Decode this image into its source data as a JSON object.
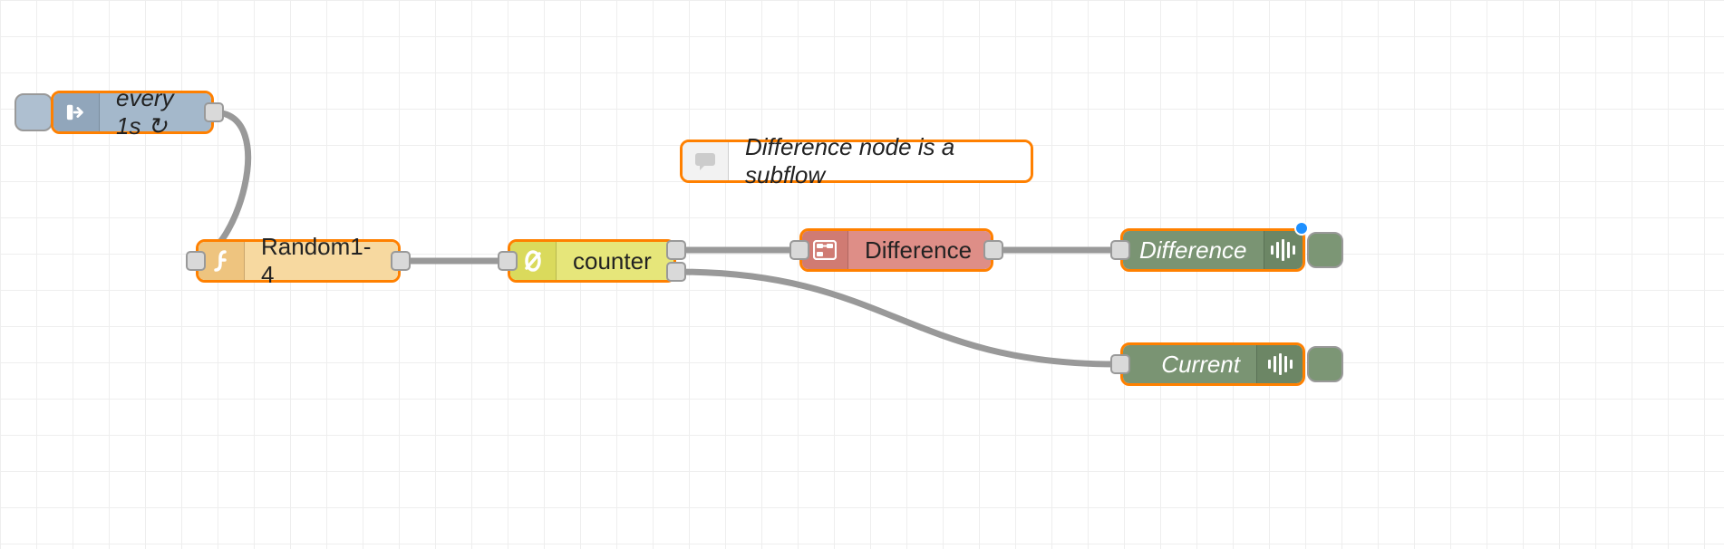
{
  "nodes": {
    "inject": {
      "label": "every 1s ↻"
    },
    "function": {
      "label": "Random1-4"
    },
    "counter": {
      "label": "counter"
    },
    "subflow": {
      "label": "Difference"
    },
    "debug1": {
      "label": "Difference"
    },
    "debug2": {
      "label": "Current"
    },
    "comment": {
      "label": "Difference node is a subflow"
    }
  },
  "colors": {
    "selection": "#ff8000",
    "wire": "#999999"
  }
}
